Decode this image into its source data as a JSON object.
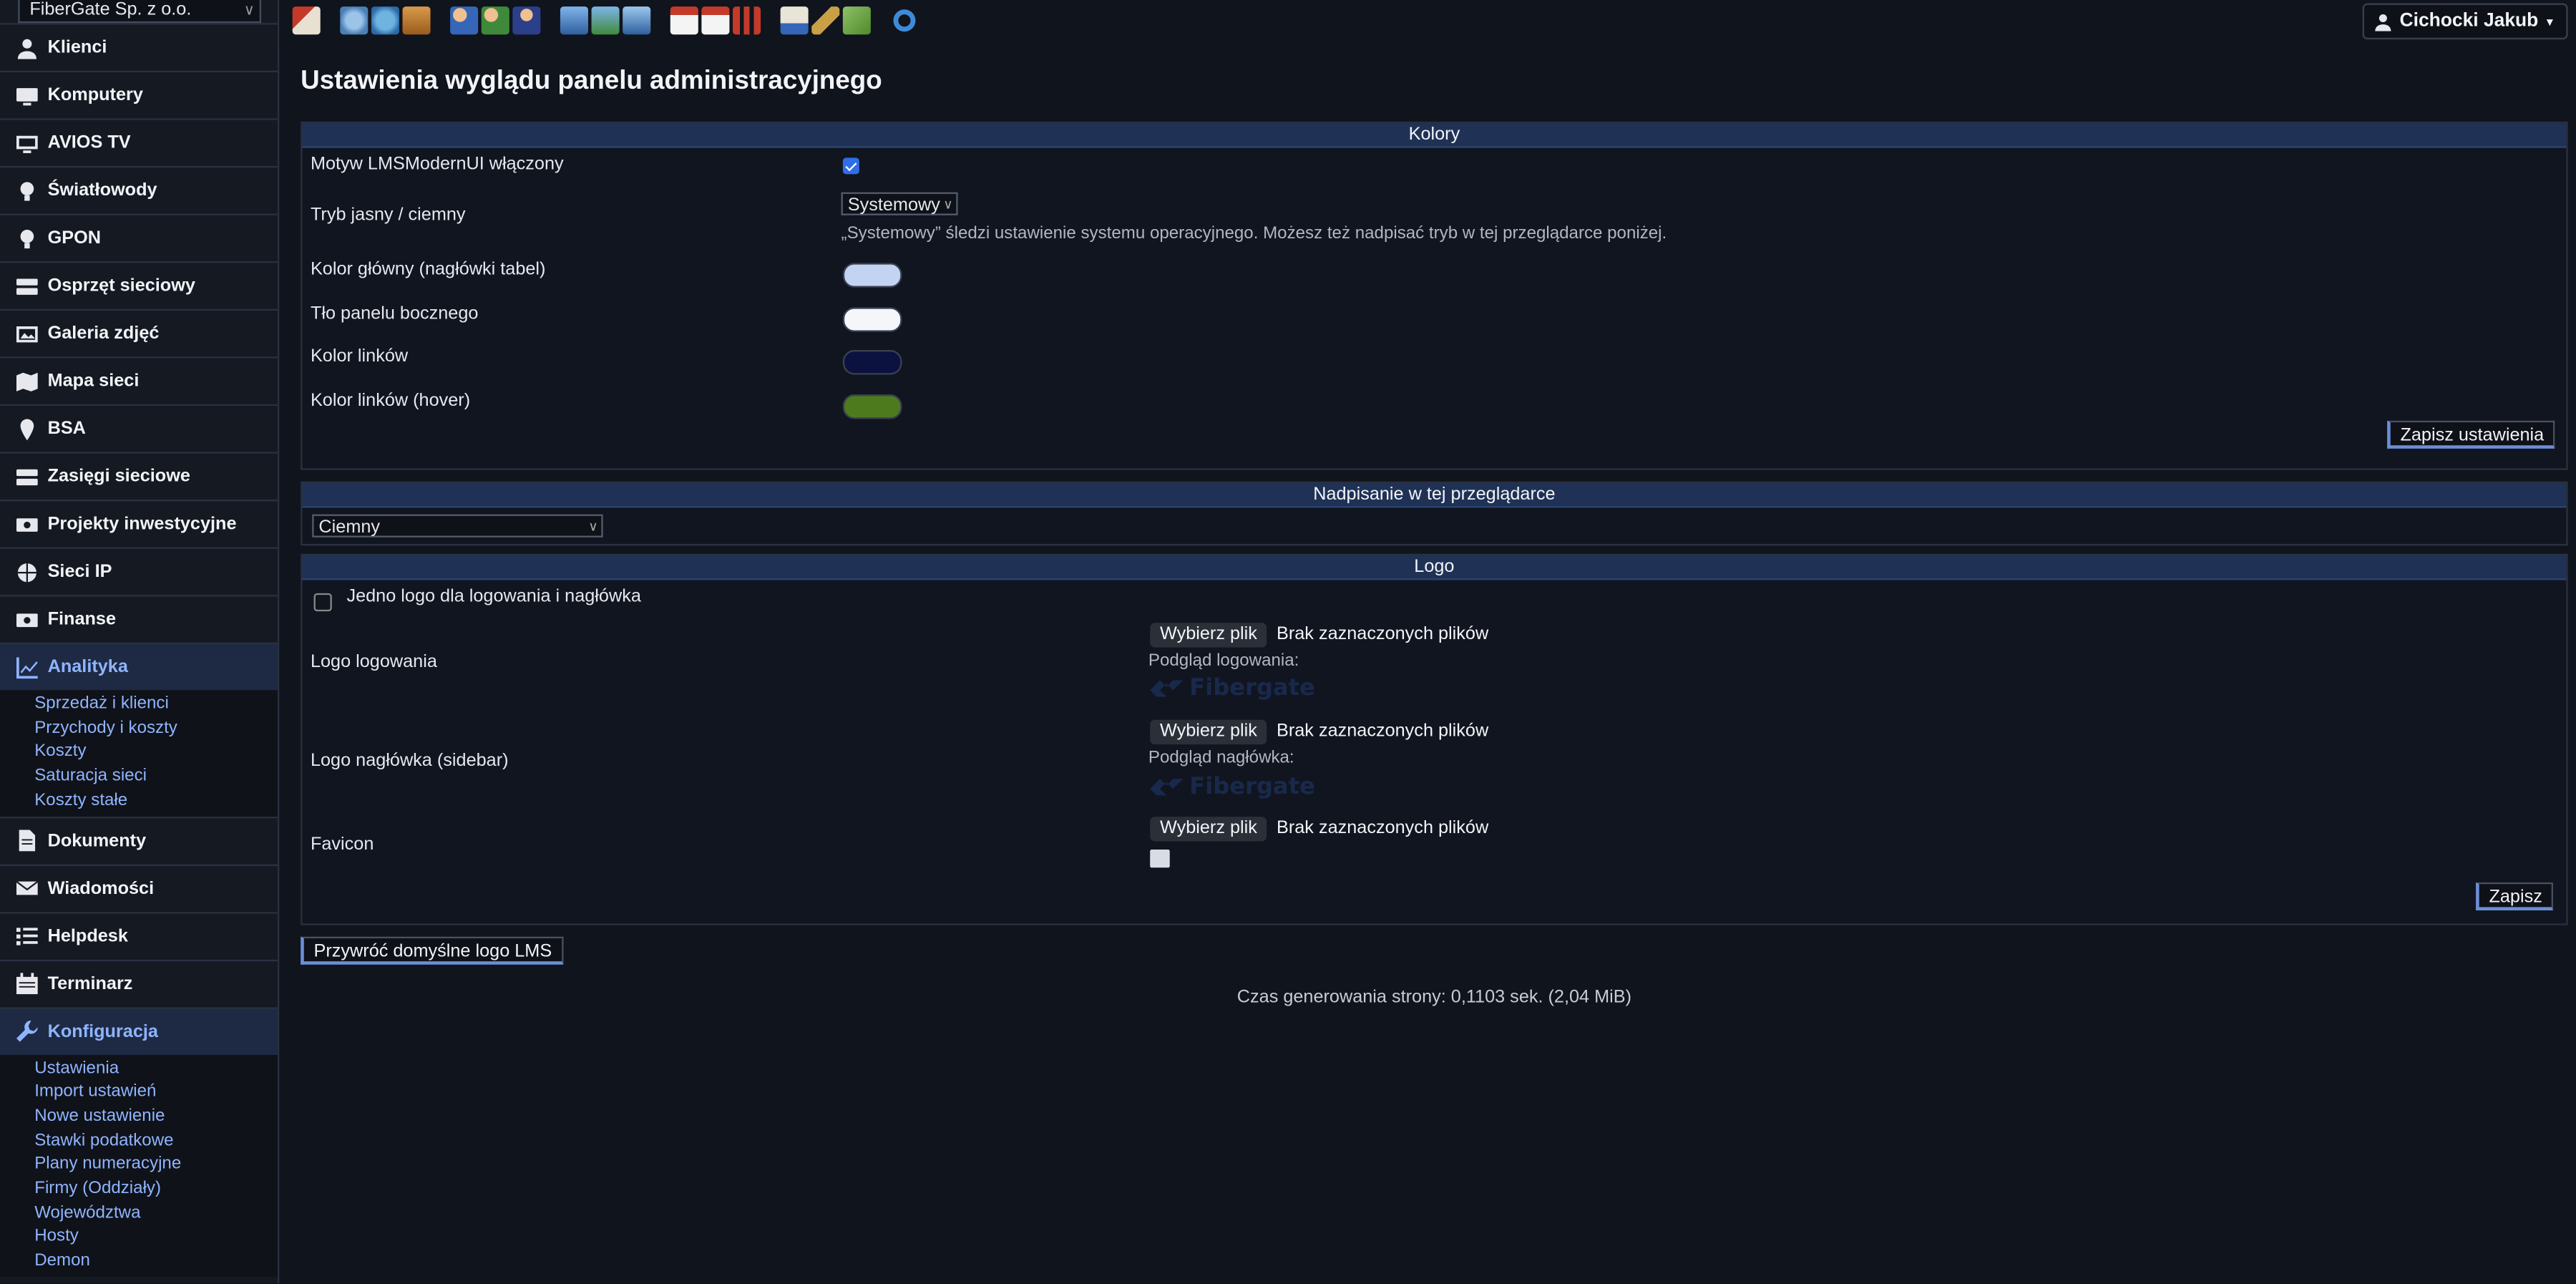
{
  "company": "FiberGate Sp. z o.o.",
  "user": "Cichocki Jakub",
  "toolbar_icons": [
    "home-icon",
    "customers-icon",
    "map-icon",
    "box-icon",
    "users-icon",
    "add-user-icon",
    "user-admin-icon",
    "computers-icon",
    "add-computer-icon",
    "monitor-icon",
    "calendar-10-icon",
    "calendar-16-icon",
    "stats-icon",
    "invoice-icon",
    "tools-icon",
    "money-icon",
    "refresh-icon"
  ],
  "sidebar": {
    "items": [
      {
        "label": "Klienci",
        "icon": "user-icon"
      },
      {
        "label": "Komputery",
        "icon": "monitor-icon"
      },
      {
        "label": "AVIOS TV",
        "icon": "tv-icon"
      },
      {
        "label": "Światłowody",
        "icon": "bulb-icon"
      },
      {
        "label": "GPON",
        "icon": "bulb-icon"
      },
      {
        "label": "Osprzęt sieciowy",
        "icon": "server-icon"
      },
      {
        "label": "Galeria zdjęć",
        "icon": "image-icon"
      },
      {
        "label": "Mapa sieci",
        "icon": "map-icon"
      },
      {
        "label": "BSA",
        "icon": "pin-icon"
      },
      {
        "label": "Zasięgi sieciowe",
        "icon": "server-icon"
      },
      {
        "label": "Projekty inwestycyjne",
        "icon": "money-icon"
      },
      {
        "label": "Sieci IP",
        "icon": "globe-icon"
      },
      {
        "label": "Finanse",
        "icon": "money-icon"
      },
      {
        "label": "Analityka",
        "icon": "chart-icon",
        "active": true
      },
      {
        "label": "Dokumenty",
        "icon": "document-icon"
      },
      {
        "label": "Wiadomości",
        "icon": "envelope-icon"
      },
      {
        "label": "Helpdesk",
        "icon": "list-icon"
      },
      {
        "label": "Terminarz",
        "icon": "calendar-icon"
      },
      {
        "label": "Konfiguracja",
        "icon": "wrench-icon",
        "active": true
      }
    ],
    "analityka_sub": [
      "Sprzedaż i klienci",
      "Przychody i koszty",
      "Koszty",
      "Saturacja sieci",
      "Koszty stałe"
    ],
    "konfiguracja_sub": [
      "Ustawienia",
      "Import ustawień",
      "Nowe ustawienie",
      "Stawki podatkowe",
      "Plany numeracyjne",
      "Firmy (Oddziały)",
      "Województwa",
      "Hosty",
      "Demon"
    ]
  },
  "page": {
    "title": "Ustawienia wyglądu panelu administracyjnego",
    "colors": {
      "head": "Kolory",
      "theme_enabled_label": "Motyw LMSModernUI włączony",
      "mode_label": "Tryb jasny / ciemny",
      "mode_value": "Systemowy",
      "mode_hint": "„Systemowy” śledzi ustawienie systemu operacyjnego. Możesz też nadpisać tryb w tej przeglądarce poniżej.",
      "primary_label": "Kolor główny (nagłówki tabel)",
      "primary_color": "#c3d3f2",
      "sidebar_bg_label": "Tło panelu bocznego",
      "sidebar_bg_color": "#f4f6fa",
      "link_label": "Kolor linków",
      "link_color": "#0b1240",
      "link_hover_label": "Kolor linków (hover)",
      "link_hover_color": "#4e7a1e",
      "save": "Zapisz ustawienia"
    },
    "override": {
      "head": "Nadpisanie w tej przeglądarce",
      "value": "Ciemny"
    },
    "logo": {
      "head": "Logo",
      "single_logo_label": "Jedno logo dla logowania i nagłówka",
      "login_logo_label": "Logo logowania",
      "header_logo_label": "Logo nagłówka (sidebar)",
      "favicon_label": "Favicon",
      "choose_file": "Wybierz plik",
      "no_file": "Brak zaznaczonych plików",
      "login_preview": "Podgląd logowania:",
      "header_preview": "Podgląd nagłówka:",
      "brand": "Fibergate",
      "save": "Zapisz",
      "restore": "Przywróć domyślne logo LMS"
    },
    "footer": "Czas generowania strony: 0,1103 sek. (2,04 MiB)"
  }
}
